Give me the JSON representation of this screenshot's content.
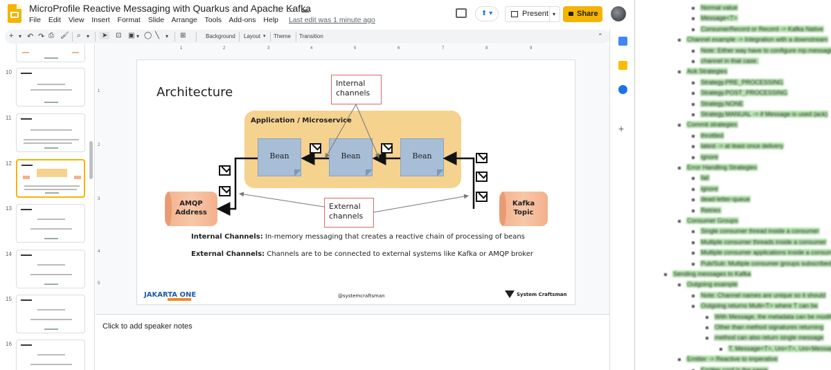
{
  "app": {
    "title": "MicroProfile Reactive Messaging with Quarkus and Apache Kafka",
    "menu": [
      "File",
      "Edit",
      "View",
      "Insert",
      "Format",
      "Slide",
      "Arrange",
      "Tools",
      "Add-ons",
      "Help"
    ],
    "last_edit": "Last edit was 1 minute ago",
    "present_label": "Present",
    "share_label": "Share"
  },
  "toolbar": {
    "background": "Background",
    "layout": "Layout",
    "theme": "Theme",
    "transition": "Transition"
  },
  "filmstrip": {
    "slide_numbers": [
      "10",
      "11",
      "12",
      "13",
      "14",
      "15",
      "16"
    ],
    "selected": "12"
  },
  "ruler": {
    "h": [
      "1",
      "1",
      "2",
      "3",
      "4",
      "5",
      "6",
      "7",
      "8",
      "9"
    ],
    "v": [
      "1",
      "2",
      "3",
      "4",
      "5"
    ]
  },
  "slide": {
    "title": "Architecture",
    "app_box_label": "Application / Microservice",
    "beans": [
      "Bean",
      "Bean",
      "Bean"
    ],
    "internal_callout": [
      "Internal",
      "channels"
    ],
    "external_callout": [
      "External",
      "channels"
    ],
    "amqp": [
      "AMQP",
      "Address"
    ],
    "kafka": [
      "Kafka",
      "Topic"
    ],
    "note1_bold": "Internal Channels:",
    "note1_text": " In-memory messaging that creates a reactive chain of processing of beans",
    "note2_bold": "External Channels:",
    "note2_text": " Channels are to be connected to external systems like Kafka or AMQP broker",
    "footer_handle": "@systemcraftsman",
    "jakarta_logo": "JAKARTA ONE",
    "sc_logo": "System Craftsman"
  },
  "speaker_notes": {
    "placeholder": "Click to add speaker notes"
  },
  "doc": {
    "lines": [
      "Normal value",
      "Message<T>",
      "ConsumerRecord or Record -> Kafka Native",
      "Channel example -> Integration with a downstream",
      "Note: Either way have to configure mp.messaging",
      "channel in that case.",
      "Ack Strategies",
      "Strategy.PRE_PROCESSING",
      "Strategy.POST_PROCESSING",
      "Strategy.NONE",
      "Strategy.MANUAL -> if Message is used (ack)",
      "Commit strategies",
      "throttled",
      "latest -> at least once delivery",
      "ignore",
      "Error Handling Strategies",
      "fail",
      "ignore",
      "dead-letter-queue",
      "Retries",
      "Consumer Groups",
      "Single consumer thread inside a consumer",
      "Multiple consumer threads inside a consumer",
      "Multiple consumer applications inside a consumer",
      "Pub/Sub: Multiple consumer groups subscribed",
      "Sending messages to Kafka",
      "Outgoing example",
      "Note: Channel names are unique so it should",
      "Outgoing returns Multi<T> where T can be",
      "With Message, the metadata can be modified",
      "Other than method signatures returning",
      "method can also return single message",
      "T, Message<T>, Uni<T>, Uni<Message<T>>",
      "Emitter -> Reactive to imperative",
      "Emitter conf is the same"
    ]
  }
}
